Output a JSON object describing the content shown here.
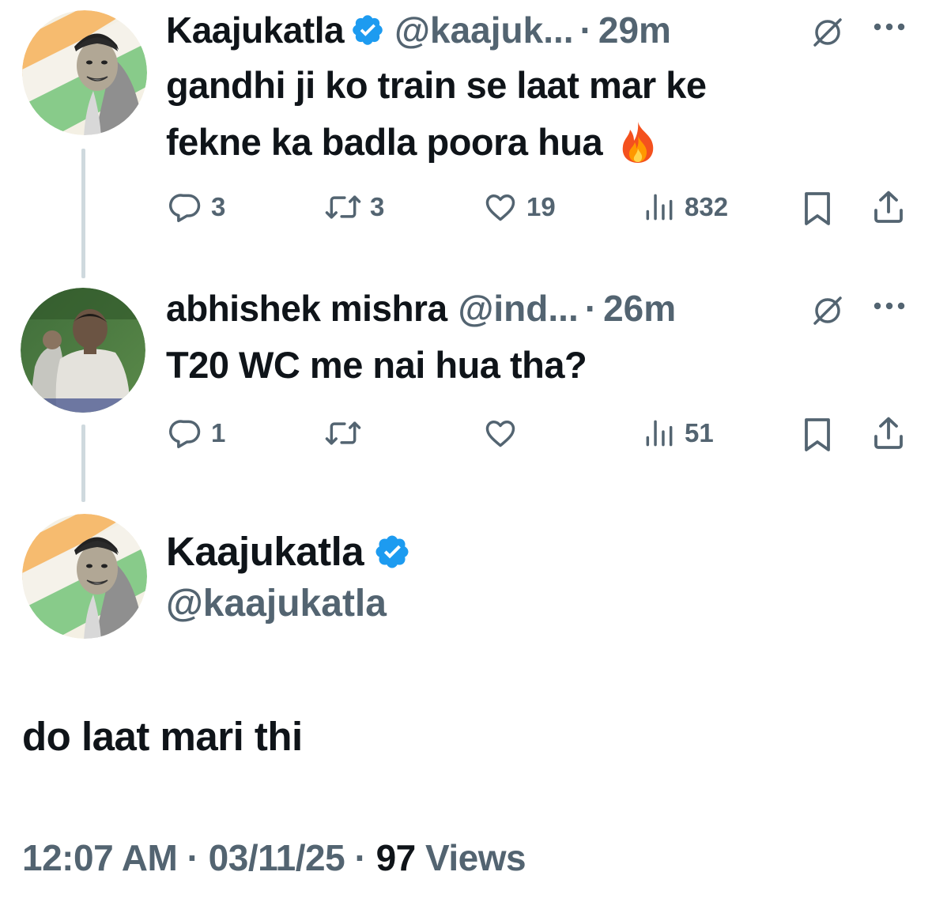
{
  "tweets": [
    {
      "name": "Kaajukatla",
      "handle": "@kaajuk...",
      "separator": "·",
      "time": "29m",
      "text_line1": "gandhi ji ko train se laat mar ke",
      "text_line2": "fekne ka badla poora hua",
      "emoji": "fire",
      "verified": true,
      "replies": "3",
      "reposts": "3",
      "likes": "19",
      "views": "832"
    },
    {
      "name": "abhishek mishra",
      "handle": "@ind...",
      "separator": "·",
      "time": "26m",
      "text_line1": "T20 WC me nai hua tha?",
      "verified": false,
      "replies": "1",
      "reposts": "",
      "likes": "",
      "views": "51"
    }
  ],
  "main_tweet": {
    "name": "Kaajukatla",
    "handle": "@kaajukatla",
    "verified": true,
    "text": "do laat mari thi",
    "time": "12:07 AM",
    "date": "03/11/25",
    "separator": "·",
    "views_count": "97",
    "views_label": "Views"
  },
  "colors": {
    "text": "#0f1419",
    "secondary": "#536471",
    "verified": "#1d9bf0",
    "thread_line": "#cfd9de"
  },
  "icons": [
    "reply-icon",
    "repost-icon",
    "like-icon",
    "views-icon",
    "bookmark-icon",
    "share-icon",
    "grok-icon",
    "more-icon",
    "verified-badge-icon",
    "fire-emoji"
  ]
}
